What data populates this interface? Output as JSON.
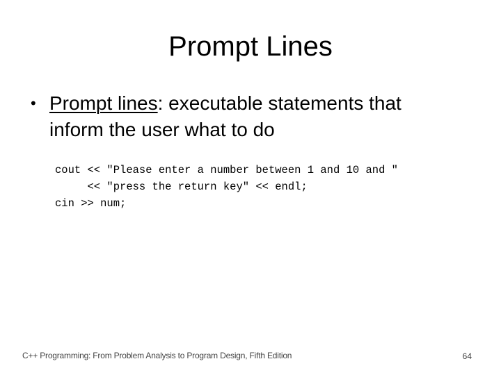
{
  "slide": {
    "title": "Prompt Lines",
    "bullet": {
      "term": "Prompt lines",
      "separator": ":",
      "definition_line1": " executable statements that",
      "definition_line2": "inform the user what to do"
    },
    "code_lines": [
      "cout << \"Please enter a number between 1 and 10 and \"",
      "     << \"press the return key\" << endl;",
      "cin >> num;"
    ],
    "footer": "C++ Programming: From Problem Analysis to Program Design, Fifth Edition",
    "page_number": "64"
  }
}
